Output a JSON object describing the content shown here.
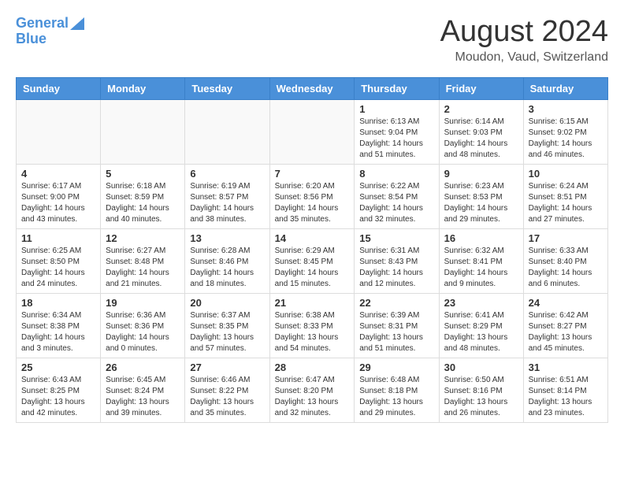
{
  "logo": {
    "line1": "General",
    "line2": "Blue"
  },
  "title": "August 2024",
  "location": "Moudon, Vaud, Switzerland",
  "headers": [
    "Sunday",
    "Monday",
    "Tuesday",
    "Wednesday",
    "Thursday",
    "Friday",
    "Saturday"
  ],
  "weeks": [
    [
      {
        "day": "",
        "info": ""
      },
      {
        "day": "",
        "info": ""
      },
      {
        "day": "",
        "info": ""
      },
      {
        "day": "",
        "info": ""
      },
      {
        "day": "1",
        "info": "Sunrise: 6:13 AM\nSunset: 9:04 PM\nDaylight: 14 hours\nand 51 minutes."
      },
      {
        "day": "2",
        "info": "Sunrise: 6:14 AM\nSunset: 9:03 PM\nDaylight: 14 hours\nand 48 minutes."
      },
      {
        "day": "3",
        "info": "Sunrise: 6:15 AM\nSunset: 9:02 PM\nDaylight: 14 hours\nand 46 minutes."
      }
    ],
    [
      {
        "day": "4",
        "info": "Sunrise: 6:17 AM\nSunset: 9:00 PM\nDaylight: 14 hours\nand 43 minutes."
      },
      {
        "day": "5",
        "info": "Sunrise: 6:18 AM\nSunset: 8:59 PM\nDaylight: 14 hours\nand 40 minutes."
      },
      {
        "day": "6",
        "info": "Sunrise: 6:19 AM\nSunset: 8:57 PM\nDaylight: 14 hours\nand 38 minutes."
      },
      {
        "day": "7",
        "info": "Sunrise: 6:20 AM\nSunset: 8:56 PM\nDaylight: 14 hours\nand 35 minutes."
      },
      {
        "day": "8",
        "info": "Sunrise: 6:22 AM\nSunset: 8:54 PM\nDaylight: 14 hours\nand 32 minutes."
      },
      {
        "day": "9",
        "info": "Sunrise: 6:23 AM\nSunset: 8:53 PM\nDaylight: 14 hours\nand 29 minutes."
      },
      {
        "day": "10",
        "info": "Sunrise: 6:24 AM\nSunset: 8:51 PM\nDaylight: 14 hours\nand 27 minutes."
      }
    ],
    [
      {
        "day": "11",
        "info": "Sunrise: 6:25 AM\nSunset: 8:50 PM\nDaylight: 14 hours\nand 24 minutes."
      },
      {
        "day": "12",
        "info": "Sunrise: 6:27 AM\nSunset: 8:48 PM\nDaylight: 14 hours\nand 21 minutes."
      },
      {
        "day": "13",
        "info": "Sunrise: 6:28 AM\nSunset: 8:46 PM\nDaylight: 14 hours\nand 18 minutes."
      },
      {
        "day": "14",
        "info": "Sunrise: 6:29 AM\nSunset: 8:45 PM\nDaylight: 14 hours\nand 15 minutes."
      },
      {
        "day": "15",
        "info": "Sunrise: 6:31 AM\nSunset: 8:43 PM\nDaylight: 14 hours\nand 12 minutes."
      },
      {
        "day": "16",
        "info": "Sunrise: 6:32 AM\nSunset: 8:41 PM\nDaylight: 14 hours\nand 9 minutes."
      },
      {
        "day": "17",
        "info": "Sunrise: 6:33 AM\nSunset: 8:40 PM\nDaylight: 14 hours\nand 6 minutes."
      }
    ],
    [
      {
        "day": "18",
        "info": "Sunrise: 6:34 AM\nSunset: 8:38 PM\nDaylight: 14 hours\nand 3 minutes."
      },
      {
        "day": "19",
        "info": "Sunrise: 6:36 AM\nSunset: 8:36 PM\nDaylight: 14 hours\nand 0 minutes."
      },
      {
        "day": "20",
        "info": "Sunrise: 6:37 AM\nSunset: 8:35 PM\nDaylight: 13 hours\nand 57 minutes."
      },
      {
        "day": "21",
        "info": "Sunrise: 6:38 AM\nSunset: 8:33 PM\nDaylight: 13 hours\nand 54 minutes."
      },
      {
        "day": "22",
        "info": "Sunrise: 6:39 AM\nSunset: 8:31 PM\nDaylight: 13 hours\nand 51 minutes."
      },
      {
        "day": "23",
        "info": "Sunrise: 6:41 AM\nSunset: 8:29 PM\nDaylight: 13 hours\nand 48 minutes."
      },
      {
        "day": "24",
        "info": "Sunrise: 6:42 AM\nSunset: 8:27 PM\nDaylight: 13 hours\nand 45 minutes."
      }
    ],
    [
      {
        "day": "25",
        "info": "Sunrise: 6:43 AM\nSunset: 8:25 PM\nDaylight: 13 hours\nand 42 minutes."
      },
      {
        "day": "26",
        "info": "Sunrise: 6:45 AM\nSunset: 8:24 PM\nDaylight: 13 hours\nand 39 minutes."
      },
      {
        "day": "27",
        "info": "Sunrise: 6:46 AM\nSunset: 8:22 PM\nDaylight: 13 hours\nand 35 minutes."
      },
      {
        "day": "28",
        "info": "Sunrise: 6:47 AM\nSunset: 8:20 PM\nDaylight: 13 hours\nand 32 minutes."
      },
      {
        "day": "29",
        "info": "Sunrise: 6:48 AM\nSunset: 8:18 PM\nDaylight: 13 hours\nand 29 minutes."
      },
      {
        "day": "30",
        "info": "Sunrise: 6:50 AM\nSunset: 8:16 PM\nDaylight: 13 hours\nand 26 minutes."
      },
      {
        "day": "31",
        "info": "Sunrise: 6:51 AM\nSunset: 8:14 PM\nDaylight: 13 hours\nand 23 minutes."
      }
    ]
  ]
}
